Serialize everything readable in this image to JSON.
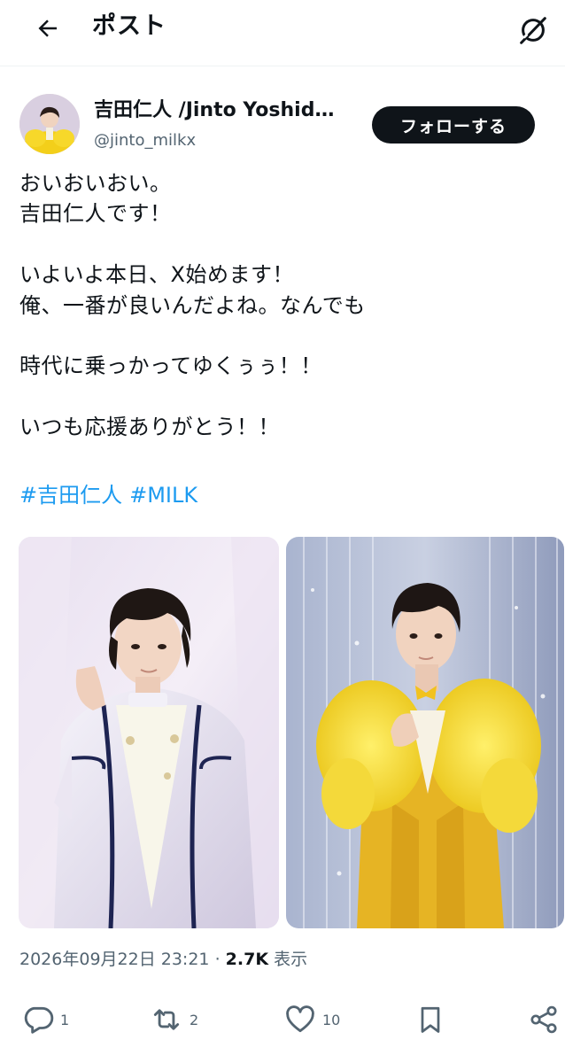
{
  "header": {
    "title": "ポスト",
    "back_icon": "arrow-left-icon",
    "grok_icon": "grok-icon"
  },
  "author": {
    "display_name": "吉田仁人 /Jinto Yoshid…",
    "handle": "@jinto_milkx",
    "follow_label": "フォローする"
  },
  "post": {
    "text": "おいおいおい。\n吉田仁人です！\n\nいよいよ本日、X始めます！\n俺、一番が良いんだよね。なんでも\n\n時代に乗っかってゆくぅぅ！！\n\nいつも応援ありがとう！！",
    "hashtags": [
      "#吉田仁人",
      "#MILK"
    ]
  },
  "meta": {
    "timestamp": "2026年09月22日 23:21",
    "separator": "·",
    "views_count": "2.7K",
    "views_label": "表示"
  },
  "actions": {
    "replies": "1",
    "reposts": "2",
    "likes": "10"
  },
  "colors": {
    "accent": "#1d9bf0",
    "text": "#0f1419",
    "muted": "#536471",
    "follow_bg": "#0f1419"
  }
}
